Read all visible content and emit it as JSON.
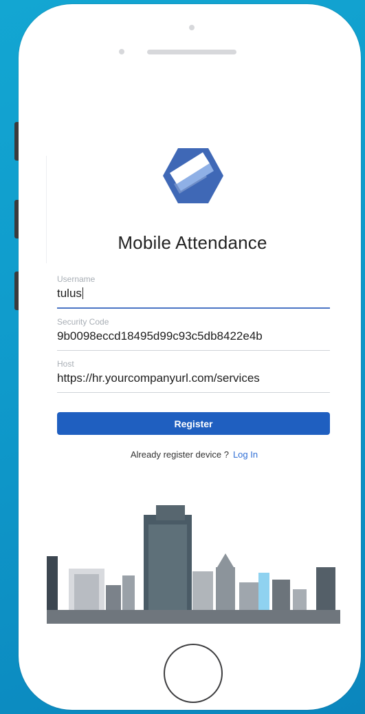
{
  "app": {
    "title": "Mobile Attendance"
  },
  "form": {
    "username": {
      "label": "Username",
      "value": "tulus"
    },
    "security_code": {
      "label": "Security Code",
      "value": "9b0098eccd18495d99c93c5db8422e4b"
    },
    "host": {
      "label": "Host",
      "value": "https://hr.yourcompanyurl.com/services"
    }
  },
  "actions": {
    "register_label": "Register",
    "already_text": "Already register device ?",
    "login_label": "Log In"
  },
  "colors": {
    "background": "#0f9acb",
    "primary_button": "#1f5fc0",
    "link": "#2f6fd6",
    "logo": "#3f68b6",
    "active_underline": "#4a74c4"
  },
  "icons": {
    "logo": "app-logo-icon",
    "home_button": "home-button-icon"
  }
}
